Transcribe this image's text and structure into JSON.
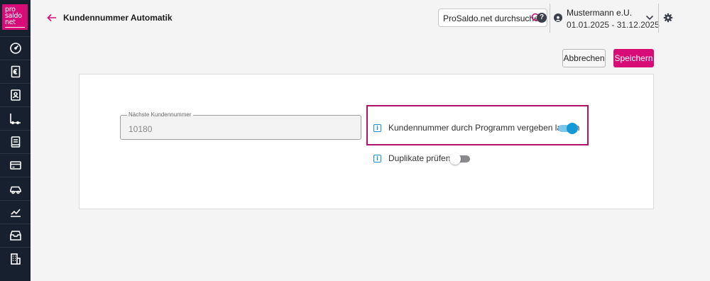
{
  "sidebar": {
    "logo_lines": [
      "pro",
      "saldo",
      "net"
    ],
    "items": [
      {
        "icon": "dashboard-gauge-icon"
      },
      {
        "icon": "euro-document-icon"
      },
      {
        "icon": "contacts-icon"
      },
      {
        "icon": "ledger-corner-icon"
      },
      {
        "icon": "book-icon"
      },
      {
        "icon": "credit-card-icon"
      },
      {
        "icon": "car-icon"
      },
      {
        "icon": "line-chart-icon"
      },
      {
        "icon": "archive-box-icon"
      },
      {
        "icon": "building-icon"
      }
    ]
  },
  "header": {
    "title": "Kundennummer Automatik",
    "search_placeholder": "ProSaldo.net durchsuchen",
    "company_name": "Mustermann e.U.",
    "period": "01.01.2025 - 31.12.2025"
  },
  "toolbar": {
    "cancel_label": "Abbrechen",
    "save_label": "Speichern"
  },
  "form": {
    "next_number_label": "Nächste Kundennummer",
    "next_number_value": "10180",
    "option_auto_label": "Kundennummer durch Programm vergeben lassen",
    "option_auto_enabled": true,
    "option_duplicates_label": "Duplikate prüfen",
    "option_duplicates_enabled": false
  },
  "colors": {
    "brand": "#d70c77",
    "sidebar": "#17202f",
    "toggle_on": "#1598d6",
    "highlight": "#b0126a"
  }
}
